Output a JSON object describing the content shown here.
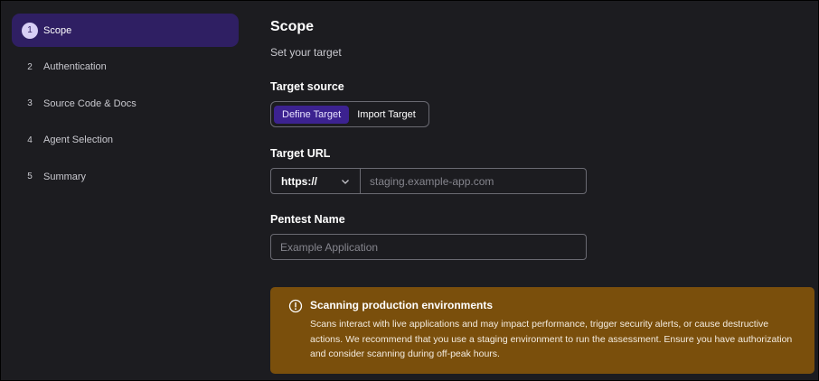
{
  "sidebar": {
    "steps": [
      {
        "number": "1",
        "label": "Scope",
        "active": true
      },
      {
        "number": "2",
        "label": "Authentication"
      },
      {
        "number": "3",
        "label": "Source Code & Docs"
      },
      {
        "number": "4",
        "label": "Agent Selection"
      },
      {
        "number": "5",
        "label": "Summary"
      }
    ]
  },
  "main": {
    "title": "Scope",
    "subtitle": "Set your target",
    "target_source": {
      "label": "Target source",
      "options": [
        "Define Target",
        "Import Target"
      ],
      "selected": "Define Target"
    },
    "target_url": {
      "label": "Target URL",
      "protocol": "https://",
      "placeholder": "staging.example-app.com"
    },
    "pentest_name": {
      "label": "Pentest Name",
      "placeholder": "Example Application"
    },
    "warning": {
      "icon": "alert-circle-icon",
      "title": "Scanning production environments",
      "body": "Scans interact with live applications and may impact performance, trigger security alerts, or cause destructive actions. We recommend that you use a staging environment to run the assessment. Ensure you have authorization and consider scanning during off-peak hours."
    }
  },
  "colors": {
    "background": "#1c1c20",
    "active_step": "#2f1f63",
    "selected_segment": "#3c2290",
    "warning": "#7a4f0c"
  }
}
